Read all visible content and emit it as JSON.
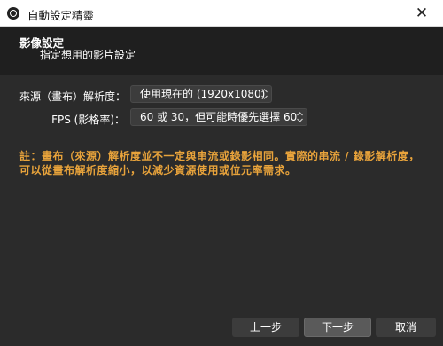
{
  "window": {
    "title": "自動設定精靈",
    "close_glyph": "✕",
    "icon": "obs-logo-icon"
  },
  "header": {
    "title": "影像設定",
    "subtitle": "指定想用的影片設定"
  },
  "form": {
    "resolution_label": "來源（畫布）解析度：",
    "resolution_value": "使用現在的 (1920x1080)",
    "fps_label": "FPS (影格率)：",
    "fps_value": "60 或 30，但可能時優先選擇 60"
  },
  "note": {
    "text": "註：畫布（來源）解析度並不一定與串流或錄影相同。實際的串流 / 錄影解析度，可以從畫布解析度縮小，以減少資源使用或位元率需求。"
  },
  "buttons": {
    "back": "上一步",
    "next": "下一步",
    "cancel": "取消"
  },
  "colors": {
    "background": "#2b2b2b",
    "header_background": "#1f1f1f",
    "note_text": "#e8a33b"
  }
}
